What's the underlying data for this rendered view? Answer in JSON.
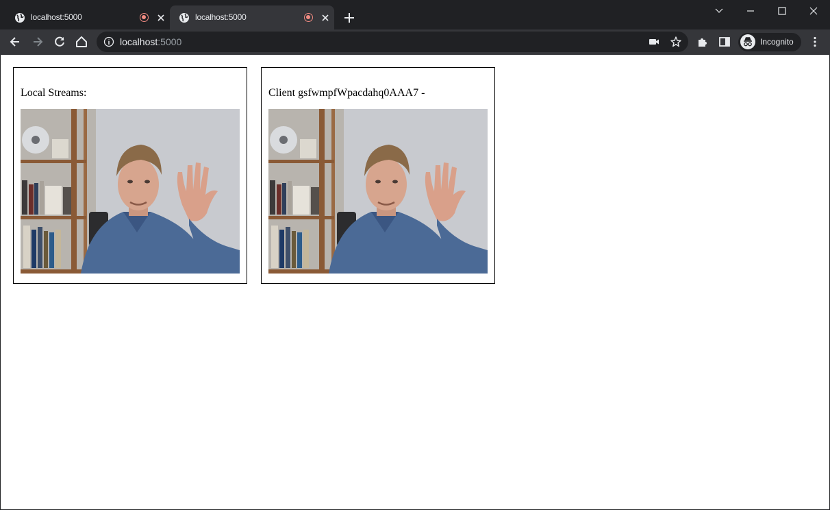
{
  "browser": {
    "tabs": [
      {
        "title": "localhost:5000",
        "active": false,
        "recording": true
      },
      {
        "title": "localhost:5000",
        "active": true,
        "recording": true
      }
    ],
    "address_bar": {
      "host": "localhost",
      "port": ":5000"
    },
    "profile_label": "Incognito"
  },
  "page": {
    "local_stream": {
      "caption": "Local Streams:"
    },
    "remote_stream": {
      "caption": "Client gsfwmpfWpacdahq0AAA7 -"
    }
  },
  "colors": {
    "chrome_dark": "#202124",
    "chrome_toolbar": "#35363a",
    "recording_indicator": "#f28b82",
    "page_background": "#ffffff"
  },
  "icons": [
    "globe-icon",
    "recording-icon",
    "close-icon",
    "plus-icon",
    "chevron-down-icon",
    "minimize-icon",
    "maximize-icon",
    "window-close-icon",
    "back-icon",
    "forward-icon",
    "reload-icon",
    "home-icon",
    "info-icon",
    "camera-icon",
    "star-icon",
    "extensions-icon",
    "side-panel-icon",
    "incognito-icon",
    "kebab-menu-icon"
  ]
}
